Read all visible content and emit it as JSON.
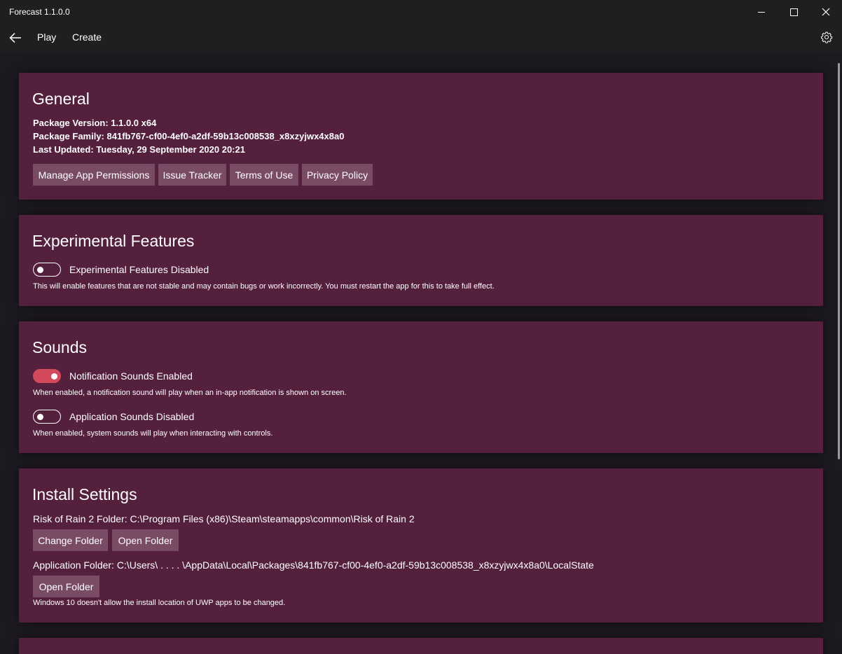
{
  "window": {
    "title": "Forecast 1.1.0.0"
  },
  "nav": {
    "back_icon": "back-arrow-icon",
    "items": [
      {
        "label": "Play"
      },
      {
        "label": "Create"
      }
    ],
    "settings_icon": "gear-icon"
  },
  "general": {
    "title": "General",
    "package_version": "Package Version: 1.1.0.0 x64",
    "package_family": "Package Family: 841fb767-cf00-4ef0-a2df-59b13c008538_x8xzyjwx4x8a0",
    "last_updated": "Last Updated: Tuesday, 29 September 2020 20:21",
    "buttons": [
      {
        "label": "Manage App Permissions"
      },
      {
        "label": "Issue Tracker"
      },
      {
        "label": "Terms of Use"
      },
      {
        "label": "Privacy Policy"
      }
    ]
  },
  "experimental": {
    "title": "Experimental Features",
    "toggle_label": "Experimental Features Disabled",
    "toggle_on": false,
    "description": "This will enable features that are not stable and may contain bugs or work incorrectly. You must restart the app for this to take full effect."
  },
  "sounds": {
    "title": "Sounds",
    "notification": {
      "label": "Notification Sounds Enabled",
      "on": true,
      "description": "When enabled, a notification sound will play when an in-app notification is shown on screen."
    },
    "application": {
      "label": "Application Sounds Disabled",
      "on": false,
      "description": "When enabled, system sounds will play when interacting with controls."
    }
  },
  "install": {
    "title": "Install Settings",
    "ror2_folder": "Risk of Rain 2 Folder: C:\\Program Files (x86)\\Steam\\steamapps\\common\\Risk of Rain 2",
    "change_folder_label": "Change Folder",
    "open_folder_label": "Open Folder",
    "app_folder": "Application Folder: C:\\Users\\ . . . . \\AppData\\Local\\Packages\\841fb767-cf00-4ef0-a2df-59b13c008538_x8xzyjwx4x8a0\\LocalState",
    "app_open_folder_label": "Open Folder",
    "note": "Windows 10 doesn't allow the install location of UWP apps to be changed."
  },
  "colors": {
    "card_background": "#551f3e",
    "button_background": "#7a4b65",
    "toggle_on": "#d44a5c",
    "titlebar": "#1f1f1f"
  }
}
